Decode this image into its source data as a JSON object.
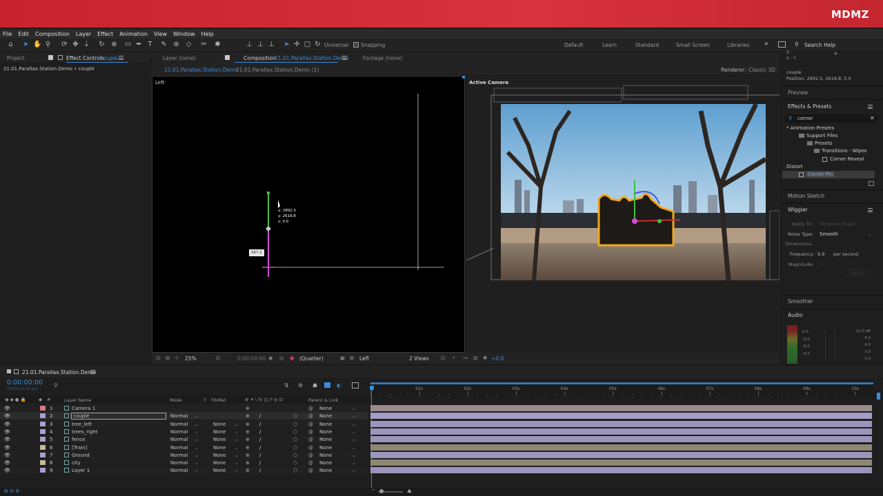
{
  "brand": "MDMZ",
  "menu": [
    "File",
    "Edit",
    "Composition",
    "Layer",
    "Effect",
    "Animation",
    "View",
    "Window",
    "Help"
  ],
  "toolbar": {
    "universal": "Universal",
    "snapping": "Snapping",
    "workspaces": [
      "Default",
      "Learn",
      "Standard",
      "Small Screen",
      "Libraries"
    ],
    "search_help": "Search Help"
  },
  "left_panel": {
    "tab_project": "Project",
    "tab_effect_controls": "Effect Controls",
    "effect_controls_layer": "couple",
    "breadcrumb": "21.01.Parallax.Station.Demo • couple"
  },
  "viewer": {
    "tab_layer": "Layer (none)",
    "tab_composition_prefix": "Composition",
    "tab_composition_name": "21.01.Parallax.Station.Demo",
    "tab_footage": "Footage (none)",
    "subtab_active": "21.01.Parallax.Station.Demo",
    "subtab_other": "21.01.Parallax.Station.Demo (1)",
    "renderer_label": "Renderer:",
    "renderer_value": "Classic 3D",
    "left_view_label": "Left",
    "active_camera_label": "Active Camera",
    "cursor_readout": [
      "x: 2892.5",
      "y: 2618.8",
      "z: 0.0"
    ],
    "value_tag": "567.2",
    "footer": {
      "zoom": "25%",
      "timecode": "0:00:00:00",
      "resolution": "(Quarter)",
      "view": "Left",
      "views": "2 Views",
      "exposure": "+0.0"
    }
  },
  "right_panel": {
    "info_line1": "B :",
    "info_line2": "A : 0",
    "info_layer": "couple",
    "info_position": "Position: 2892.5, 2618.8, 0.0",
    "preview": "Preview",
    "effects_presets": "Effects & Presets",
    "search_value": "corner",
    "tree": [
      "* Animation Presets",
      "Support Files",
      "Presets",
      "Transitions - Wipes",
      "Corner Reveal",
      "Distort",
      "Corner Pin"
    ],
    "motion_sketch": "Motion Sketch",
    "wiggler": "Wiggler",
    "apply_to_label": "Apply To:",
    "apply_to_value": "Temporal Graph",
    "noise_type_label": "Noise Type:",
    "noise_type_value": "Smooth",
    "dimensions_label": "Dimensions:",
    "frequency_label": "Frequency:",
    "frequency_value": "5.0",
    "frequency_unit": "per second",
    "magnitude_label": "Magnitude:",
    "magnitude_value": "1.0",
    "apply_button": "Apply",
    "smoother": "Smoother",
    "audio": "Audio",
    "audio_db_left": [
      "0.0",
      "-3.0",
      "-6.0",
      "-9.0"
    ],
    "audio_db_right": [
      "12.0 dB",
      "9.0",
      "6.0",
      "3.0",
      "0.0"
    ]
  },
  "timeline": {
    "comp_tab": "21.01.Parallax.Station.Demo",
    "timecode": "0:00:00:00",
    "timecode_sub": "00000 (25.00 fps)",
    "headers": {
      "layer_name": "Layer Name",
      "mode": "Mode",
      "t": "T",
      "trkmat": "TrkMat",
      "parent": "Parent & Link"
    },
    "ruler": [
      "01s",
      "02s",
      "03s",
      "04s",
      "05s",
      "06s",
      "07s",
      "08s",
      "09s",
      "10s"
    ],
    "layers": [
      {
        "num": "1",
        "name": "Camera 1",
        "mode": "",
        "trkmat": "",
        "parent": "None",
        "color": "#d97a84",
        "track": "#9c8b8e"
      },
      {
        "num": "2",
        "name": "couple",
        "mode": "Normal",
        "trkmat": "",
        "parent": "None",
        "color": "#a79fd0",
        "track": "#a49cc8"
      },
      {
        "num": "3",
        "name": "tree_left",
        "mode": "Normal",
        "trkmat": "None",
        "parent": "None",
        "color": "#a79fd0",
        "track": "#9b95bb"
      },
      {
        "num": "4",
        "name": "trees_right",
        "mode": "Normal",
        "trkmat": "None",
        "parent": "None",
        "color": "#a79fd0",
        "track": "#9b95bb"
      },
      {
        "num": "5",
        "name": "fence",
        "mode": "Normal",
        "trkmat": "None",
        "parent": "None",
        "color": "#a79fd0",
        "track": "#9b95bb"
      },
      {
        "num": "6",
        "name": "[Train]",
        "mode": "Normal",
        "trkmat": "None",
        "parent": "None",
        "color": "#c7b89a",
        "track": "#8d8774"
      },
      {
        "num": "7",
        "name": "Ground",
        "mode": "Normal",
        "trkmat": "None",
        "parent": "None",
        "color": "#a79fd0",
        "track": "#9b95bb"
      },
      {
        "num": "8",
        "name": "city",
        "mode": "Normal",
        "trkmat": "None",
        "parent": "None",
        "color": "#c7b89a",
        "track": "#8d8774"
      },
      {
        "num": "9",
        "name": "Layer 1",
        "mode": "Normal",
        "trkmat": "None",
        "parent": "None",
        "color": "#a79fd0",
        "track": "#9b95bb"
      }
    ]
  },
  "colors": {
    "accent_blue": "#3b8ddb",
    "brand_red": "#c8222f",
    "selection_orange": "#f2a81f"
  }
}
